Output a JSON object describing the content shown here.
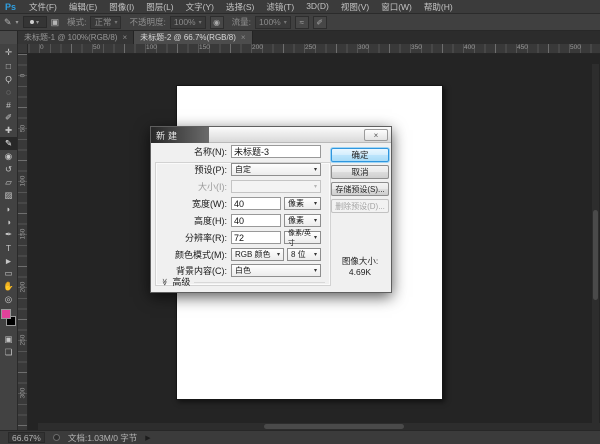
{
  "colors": {
    "accent_blue": "#2f9fe0",
    "foreground_swatch": "#e2429b",
    "background_swatch": "#000000",
    "ok_button_border": "#2f96de"
  },
  "menu_bar": {
    "logo": "Ps",
    "items": [
      {
        "name": "file",
        "label": "文件(F)"
      },
      {
        "name": "edit",
        "label": "编辑(E)"
      },
      {
        "name": "image",
        "label": "图像(I)"
      },
      {
        "name": "layer",
        "label": "图层(L)"
      },
      {
        "name": "type",
        "label": "文字(Y)"
      },
      {
        "name": "select",
        "label": "选择(S)"
      },
      {
        "name": "filter",
        "label": "滤镜(T)"
      },
      {
        "name": "3d",
        "label": "3D(D)"
      },
      {
        "name": "view",
        "label": "视图(V)"
      },
      {
        "name": "window",
        "label": "窗口(W)"
      },
      {
        "name": "help",
        "label": "帮助(H)"
      }
    ]
  },
  "options_bar": {
    "mode_label": "模式:",
    "mode_value": "正常",
    "opacity_label": "不透明度:",
    "opacity_value": "100%",
    "flow_label": "流量:",
    "flow_value": "100%"
  },
  "icons": {
    "caret": "▾",
    "brush_tool": "✎",
    "brush_panel_toggle": "▣",
    "pressure_opacity": "◉",
    "airbrush": "≈",
    "pressure_size": "✐",
    "status_arrow": "▶",
    "advanced_expander": "≫",
    "dialog_close": "×"
  },
  "tab_bar": {
    "tabs": [
      {
        "title": "未标题-1 @ 100%(RGB/8)",
        "close": "×",
        "active": false
      },
      {
        "title": "未标题-2 @ 66.7%(RGB/8)",
        "close": "×",
        "active": true
      }
    ]
  },
  "toolbox": {
    "foreground_color": "#e2429b",
    "background_color": "#000000",
    "tools": [
      {
        "name": "move-tool",
        "glyph": "✛"
      },
      {
        "name": "marquee-tool",
        "glyph": "□"
      },
      {
        "name": "lasso-tool",
        "glyph": "Ϙ"
      },
      {
        "name": "quick-selection-tool",
        "glyph": "◌"
      },
      {
        "name": "crop-tool",
        "glyph": "#"
      },
      {
        "name": "eyedropper-tool",
        "glyph": "✐"
      },
      {
        "name": "healing-brush-tool",
        "glyph": "✚"
      },
      {
        "name": "brush-tool",
        "glyph": "✎",
        "selected": true
      },
      {
        "name": "clone-stamp-tool",
        "glyph": "◉"
      },
      {
        "name": "history-brush-tool",
        "glyph": "↺"
      },
      {
        "name": "eraser-tool",
        "glyph": "▱"
      },
      {
        "name": "gradient-tool",
        "glyph": "▨"
      },
      {
        "name": "blur-tool",
        "glyph": "◗"
      },
      {
        "name": "dodge-tool",
        "glyph": "◑"
      },
      {
        "name": "pen-tool",
        "glyph": "✒"
      },
      {
        "name": "type-tool",
        "glyph": "T"
      },
      {
        "name": "path-selection-tool",
        "glyph": "►"
      },
      {
        "name": "shape-tool",
        "glyph": "▭"
      },
      {
        "name": "hand-tool",
        "glyph": "✋"
      },
      {
        "name": "zoom-tool",
        "glyph": "◎"
      }
    ]
  },
  "rulers": {
    "horizontal": [
      "0",
      "50",
      "100",
      "150",
      "200",
      "250",
      "300",
      "350",
      "400",
      "450",
      "500"
    ],
    "vertical": [
      "0",
      "50",
      "100",
      "150",
      "200",
      "250",
      "300"
    ]
  },
  "dialog": {
    "title": "新建",
    "name_label": "名称(N):",
    "name_value": "未标题-3",
    "preset_label": "预设(P):",
    "preset_value": "自定",
    "size_label": "大小(I):",
    "size_value": "",
    "width_label": "宽度(W):",
    "width_value": "40",
    "width_unit": "像素",
    "height_label": "高度(H):",
    "height_value": "40",
    "height_unit": "像素",
    "resolution_label": "分辨率(R):",
    "resolution_value": "72",
    "resolution_unit": "像素/英寸",
    "color_mode_label": "颜色模式(M):",
    "color_mode_value": "RGB 颜色",
    "bit_depth_value": "8 位",
    "background_label": "背景内容(C):",
    "background_value": "白色",
    "advanced_label": "高级",
    "ok_button": "确定",
    "cancel_button": "取消",
    "save_preset_button": "存储预设(S)...",
    "delete_preset_button": "删除预设(D)...",
    "image_size_label": "图像大小:",
    "image_size_value": "4.69K"
  },
  "status_bar": {
    "zoom_value": "66.67%",
    "doc_info": "文档:1.03M/0 字节",
    "expand_arrow": "▶"
  }
}
